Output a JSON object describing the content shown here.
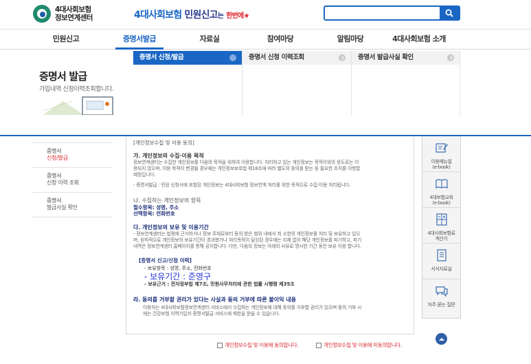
{
  "logo": {
    "line1": "4대사회보험",
    "line2": "정보연계센터"
  },
  "slogan": {
    "part1": "4대사회보험",
    "part2": "민원신고",
    "part3": "는",
    "part4": "한번에"
  },
  "search": {
    "placeholder": "",
    "value": ""
  },
  "gnb": [
    "민원신고",
    "증명서발급",
    "자료실",
    "참여마당",
    "알림마당",
    "4대사회보험 소개"
  ],
  "mega": {
    "title": "증명서 발급",
    "subtitle": "가입내역 신청이력조회합니다.",
    "columns": [
      "증명서 신청/발급",
      "증명서 신청 이력조회",
      "증명서 발급사실 확인"
    ]
  },
  "lnb": [
    {
      "l1": "증명서",
      "l2": "신청/발급"
    },
    {
      "l1": "증명서",
      "l2": "신청 이력 조회"
    },
    {
      "l1": "증명서",
      "l2": "발급사실 확인"
    }
  ],
  "content": {
    "top": "[개인정보수집 및 이용 동의]",
    "ga_h": "가. 개인정보의 수집·이용 목적",
    "ga_p1": "정보연계센터는 수집한 개인정보를 다음의 목적을 위하여 이용합니다. 처리하고 있는 개인정보는 목적이외의 용도로는 이",
    "ga_p2": "용되지 않으며, 이용 목적이 변경될 경우에는 개인정보보호법 제18조에 따라 별도의 동의를 받는 등 필요한 조치를 이행할",
    "ga_p3": "예정입니다.",
    "ga_p4": "- 증명서발급 : 민원 신청서에 포함된 개인정보는 4대사회보험 정보연계 처리를 위한 목적으로 수집·이용 처리됩니다.",
    "na_h": "나. 수집하는 개인정보의 항목",
    "na_k1": "필수항목: 성명, 주소",
    "na_k2": "선택항목: 전화번호",
    "da_h": "다. 개인정보의 보유 및 이용기간",
    "da_p1": "- 정보연계센터는 법령에 근거하거나 정보 주체로부터 동의 받은 범위 내에서 최 소한의 개인정보를 처리 및 보유하고 있으",
    "da_p2": "며, 원칙적으로 개인정보의 보유기간이 경과했거나 처리목적이 달성된 경우에는 지체 없이 해당 개인정보를 파기하고, 파기",
    "da_p3": "내역은 정보연계센터 홈페이지를 통해 공지합니다. 다만, 다음의 정보는 아래의 사유로 명시한 기간 동안 보유 이용 합니다.",
    "box_h": "[증명서 신고/신청 이력]",
    "b1": "- 보유항목 : 성명, 주소, 전화번호",
    "b2": "- 보유기간 : 준영구",
    "b3": "- 보유근거 : 전자정부법 제7조, 민원사무처리에 관한 법률 시행령 제35조",
    "ra_h": "라. 동의를 거부할 권리가 있다는 사실과 동의 거부에 따른 불이익 내용",
    "ra_p1": "이용자는 4대사회보험정보연계센터 서비스에서 수집하는 개인정보에 대해 동의를 거부할 권리가 있으며 동의 거부 시",
    "ra_p2": "에는 건강보험 지역가입자 증명서발급 서비스에 제한을 받을 수 있습니다."
  },
  "consent": {
    "agree": "개인정보수집 및 이용에 동의합니다.",
    "disagree": "개인정보수집 및 이용에 미동의합니다."
  },
  "quick": [
    {
      "icon": "pencil-note-icon",
      "l1": "이용매뉴얼",
      "l2": "(e-book)"
    },
    {
      "icon": "book-icon",
      "l1": "4대보험교육",
      "l2": "(e-book)"
    },
    {
      "icon": "calculator-icon",
      "l1": "4대사회보험료",
      "l2": "계산기"
    },
    {
      "icon": "document-icon",
      "l1": "서식자료실",
      "l2": ""
    },
    {
      "icon": "chat-bubble-icon",
      "l1": "자주 묻는 질문",
      "l2": ""
    }
  ],
  "colors": {
    "primary": "#1a66c4",
    "navy": "#1a2e7a",
    "red": "#d8262e",
    "green": "#1f8a6e"
  }
}
